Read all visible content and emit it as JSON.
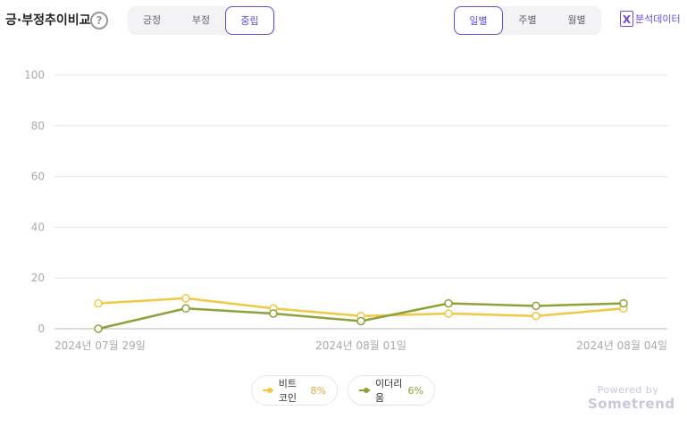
{
  "header": {
    "title": "긍·부정추이비교",
    "help_glyph": "?",
    "sentiment_tabs": [
      {
        "label": "긍정",
        "active": false
      },
      {
        "label": "부정",
        "active": false
      },
      {
        "label": "중립",
        "active": true
      }
    ],
    "period_tabs": [
      {
        "label": "일별",
        "active": true
      },
      {
        "label": "주별",
        "active": false
      },
      {
        "label": "월별",
        "active": false
      }
    ],
    "export": {
      "icon_glyph": "X",
      "label": "분석데이터"
    }
  },
  "branding": {
    "powered_by": "Powered by",
    "brand": "Sometrend"
  },
  "colors": {
    "bitcoin": "#f2c744",
    "ethereum": "#8ea23a",
    "accent": "#5b4fd6",
    "grid": "#e5e5e5"
  },
  "chart_data": {
    "type": "line",
    "x": [
      "2024년 07월 29일",
      "2024년 07월 30일",
      "2024년 07월 31일",
      "2024년 08월 01일",
      "2024년 08월 02일",
      "2024년 08월 03일",
      "2024년 08월 04일"
    ],
    "x_tick_labels": [
      "2024년 07월 29일",
      "2024년 08월 01일",
      "2024년 08월 04일"
    ],
    "x_tick_indices": [
      0,
      3,
      6
    ],
    "yticks": [
      "0",
      "20",
      "40",
      "60",
      "80",
      "100"
    ],
    "ylim": [
      0,
      100
    ],
    "grid": true,
    "series": [
      {
        "name": "비트코인",
        "pct": "8%",
        "values": [
          10,
          12,
          8,
          5,
          6,
          5,
          8
        ]
      },
      {
        "name": "이더리움",
        "pct": "6%",
        "values": [
          0,
          8,
          6,
          3,
          10,
          9,
          10
        ]
      }
    ]
  }
}
